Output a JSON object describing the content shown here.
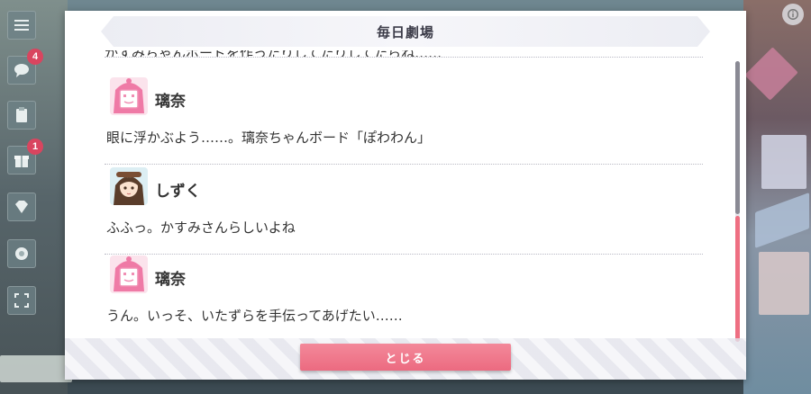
{
  "modal": {
    "title": "毎日劇場",
    "close_label": "とじる"
  },
  "log": {
    "partial_previous_line": "かすみちゃんボードを作ったりしてたりしてたらね……",
    "entries": [
      {
        "speaker": "璃奈",
        "avatar": "rina-board-avatar",
        "text": "眼に浮かぶよう……。璃奈ちゃんボード「ぽわわん」"
      },
      {
        "speaker": "しずく",
        "avatar": "shizuku-avatar",
        "text": "ふふっ。かすみさんらしいよね"
      },
      {
        "speaker": "璃奈",
        "avatar": "rina-board-avatar",
        "text": "うん。いっそ、いたずらを手伝ってあげたい……"
      }
    ]
  },
  "sidebar": {
    "badges": {
      "chat": "4",
      "gift": "1"
    }
  },
  "colors": {
    "accent": "#ec6a80",
    "rina_pink": "#f08fb4",
    "scroll_thumb": "#ee6f82"
  }
}
